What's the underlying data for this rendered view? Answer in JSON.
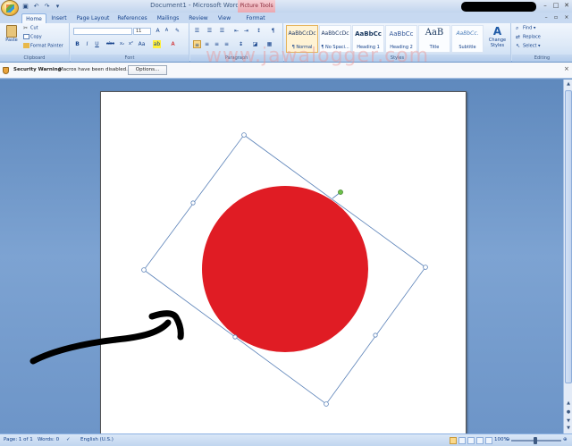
{
  "window": {
    "title": "Document1 - Microsoft Word",
    "context_tab": "Picture Tools",
    "controls": [
      "–",
      "□",
      "✕"
    ]
  },
  "quick_access": [
    "save-icon",
    "undo-icon",
    "redo-icon",
    "customize-icon"
  ],
  "tabs": [
    "Home",
    "Insert",
    "Page Layout",
    "References",
    "Mailings",
    "Review",
    "View",
    "Format"
  ],
  "active_tab": "Home",
  "ribbon": {
    "clipboard": {
      "paste": "Paste",
      "cut": "Cut",
      "copy": "Copy",
      "format_painter": "Format Painter",
      "label": "Clipboard"
    },
    "font": {
      "size": "11",
      "label": "Font"
    },
    "paragraph": {
      "label": "Paragraph"
    },
    "styles": {
      "items": [
        {
          "preview": "AaBbCcDc",
          "name": "¶ Normal"
        },
        {
          "preview": "AaBbCcDc",
          "name": "¶ No Spaci..."
        },
        {
          "preview": "AaBbCc",
          "name": "Heading 1"
        },
        {
          "preview": "AaBbCc",
          "name": "Heading 2"
        },
        {
          "preview": "AaB",
          "name": "Title"
        },
        {
          "preview": "AaBbCc.",
          "name": "Subtitle"
        }
      ],
      "change_styles": "Change Styles",
      "label": "Styles"
    },
    "editing": {
      "find": "Find",
      "replace": "Replace",
      "select": "Select",
      "label": "Editing"
    }
  },
  "security": {
    "label": "Security Warning",
    "message": "Macros have been disabled.",
    "options": "Options..."
  },
  "watermark": "www.jawalogger.com",
  "status": {
    "page": "Page: 1 of 1",
    "words": "Words: 0",
    "language": "English (U.S.)",
    "zoom": "100%"
  },
  "colors": {
    "circle": "#e01c24",
    "selection": "#5b82b8",
    "rotate_handle": "#6cc04a",
    "arrow": "#000000"
  }
}
